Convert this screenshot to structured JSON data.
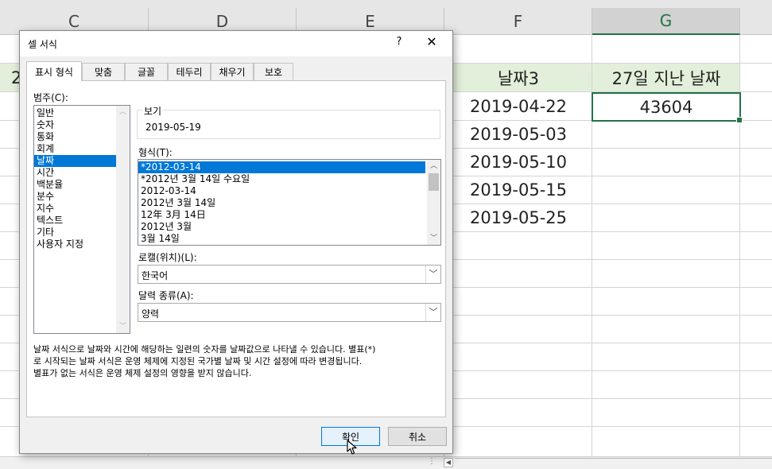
{
  "columns": [
    {
      "letter": "C",
      "selected": false
    },
    {
      "letter": "D",
      "selected": false
    },
    {
      "letter": "E",
      "selected": false
    },
    {
      "letter": "F",
      "selected": false
    },
    {
      "letter": "G",
      "selected": true
    }
  ],
  "partial_header_left": "2",
  "headers": {
    "f": "날짜3",
    "g": "27일 지난 날짜"
  },
  "f_values": [
    "2019-04-22",
    "2019-05-03",
    "2019-05-10",
    "2019-05-15",
    "2019-05-25"
  ],
  "g_value": "43604",
  "colors": {
    "header_fill": "#e2efda",
    "accent_green": "#217346",
    "selection_blue": "#0078d7"
  },
  "dialog": {
    "title": "셀 서식",
    "help": "?",
    "close": "✕",
    "tabs": [
      "표시 형식",
      "맞춤",
      "글꼴",
      "테두리",
      "채우기",
      "보호"
    ],
    "active_tab": "표시 형식",
    "category_label": "범주(C):",
    "categories": [
      "일반",
      "숫자",
      "통화",
      "회계",
      "날짜",
      "시간",
      "백분율",
      "분수",
      "지수",
      "텍스트",
      "기타",
      "사용자 지정"
    ],
    "selected_category": "날짜",
    "sample_label": "보기",
    "sample_value": "2019-05-19",
    "type_label": "형식(T):",
    "types": [
      "*2012-03-14",
      "*2012년 3월 14일 수요일",
      "2012-03-14",
      "2012년 3월 14일",
      "12年 3月 14日",
      "2012년 3월",
      "3월 14일"
    ],
    "selected_type": "*2012-03-14",
    "locale_label": "로캘(위치)(L):",
    "locale_value": "한국어",
    "calendar_label": "달력 종류(A):",
    "calendar_value": "양력",
    "description": [
      "날짜 서식으로 날짜와 시간에 해당하는 일련의 숫자를 날짜값으로 나타낼 수 있습니다. 별표(*)",
      "로 시작되는 날짜 서식은 운영 체제에 지정된 국가별 날짜 및 시간 설정에 따라 변경됩니다.",
      "별표가 없는 서식은 운영 체제 설정의 영향을 받지 않습니다."
    ],
    "ok_label": "확인",
    "cancel_label": "취소"
  },
  "icons": {
    "scroll_up": "chevron-up-icon",
    "scroll_down": "chevron-down-icon",
    "dropdown": "chevron-down-icon",
    "cursor": "arrow-cursor-icon"
  }
}
